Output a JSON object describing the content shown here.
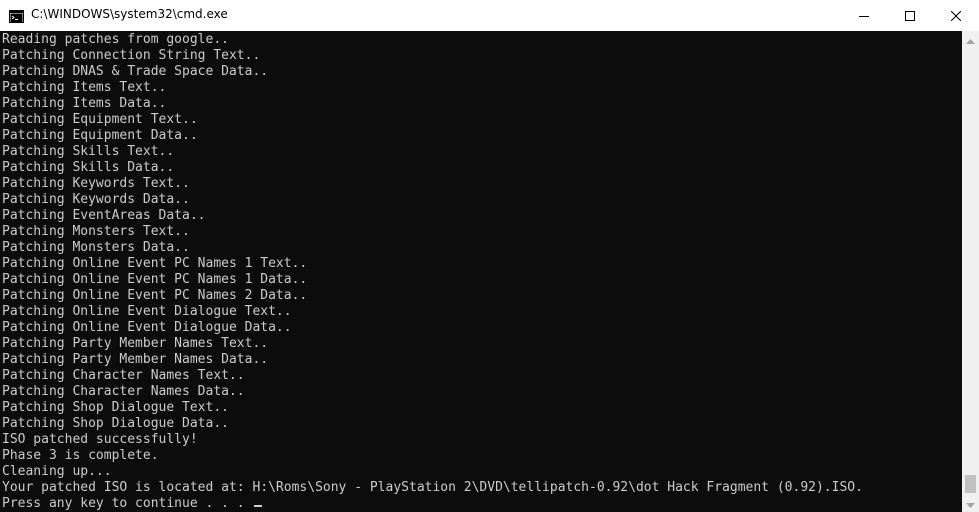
{
  "window": {
    "title": "C:\\WINDOWS\\system32\\cmd.exe",
    "app_icon": "cmd-icon",
    "controls": {
      "minimize_icon": "minimize-icon",
      "maximize_icon": "maximize-icon",
      "close_icon": "close-icon"
    }
  },
  "console": {
    "lines": [
      "Reading patches from google..",
      "Patching Connection String Text..",
      "Patching DNAS & Trade Space Data..",
      "Patching Items Text..",
      "Patching Items Data..",
      "Patching Equipment Text..",
      "Patching Equipment Data..",
      "Patching Skills Text..",
      "Patching Skills Data..",
      "Patching Keywords Text..",
      "Patching Keywords Data..",
      "Patching EventAreas Data..",
      "Patching Monsters Text..",
      "Patching Monsters Data..",
      "Patching Online Event PC Names 1 Text..",
      "Patching Online Event PC Names 1 Data..",
      "Patching Online Event PC Names 2 Data..",
      "Patching Online Event Dialogue Text..",
      "Patching Online Event Dialogue Data..",
      "Patching Party Member Names Text..",
      "Patching Party Member Names Data..",
      "Patching Character Names Text..",
      "Patching Character Names Data..",
      "Patching Shop Dialogue Text..",
      "Patching Shop Dialogue Data..",
      "ISO patched successfully!",
      "Phase 3 is complete.",
      "Cleaning up...",
      "Your patched ISO is located at: H:\\Roms\\Sony - PlayStation 2\\DVD\\tellipatch-0.92\\dot Hack Fragment (0.92).ISO."
    ],
    "prompt_line": "Press any key to continue . . . "
  },
  "colors": {
    "console_bg": "#0c0c0c",
    "console_fg": "#cccccc",
    "titlebar_bg": "#ffffff",
    "scrollbar_bg": "#f0f0f0",
    "scrollbar_thumb": "#c1c1c1"
  }
}
